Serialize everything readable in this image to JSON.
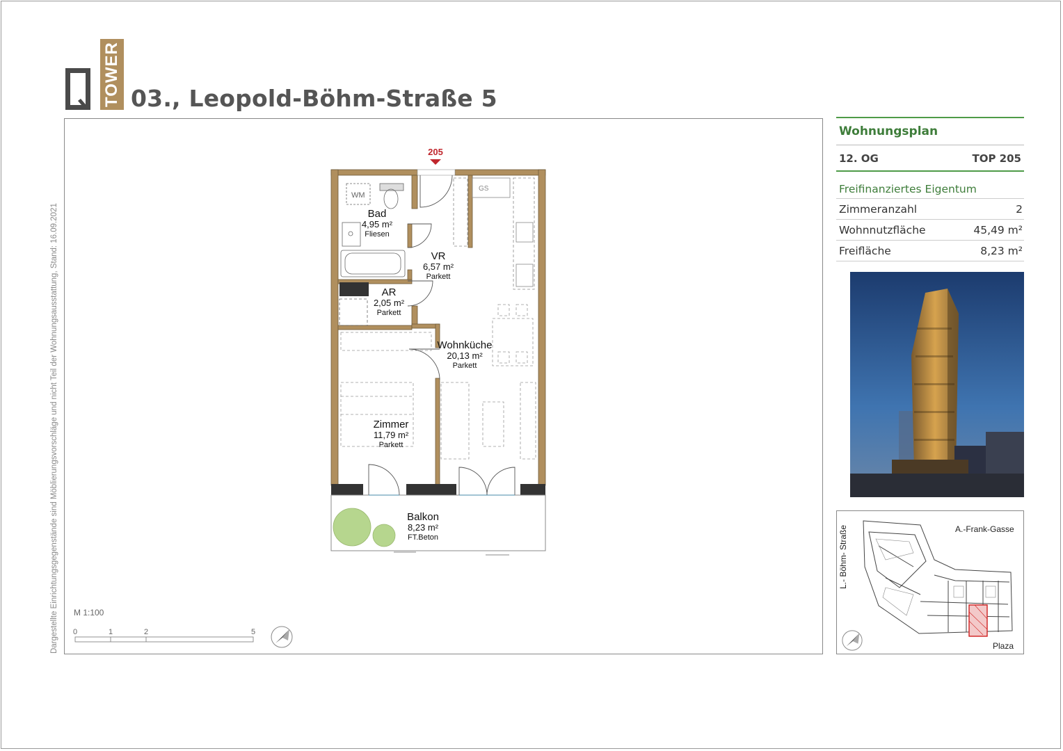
{
  "header": {
    "logo_word": "TOWER",
    "title": "03., Leopold-Böhm-Straße 5"
  },
  "disclaimer": "Dargestellte Einrichtungsgegenstände sind Möblierungsvorschläge und nicht Teil der Wohnungsausstattung, Stand: 16.09.2021",
  "plan": {
    "unit_marker": "205",
    "appliances": {
      "washer": "WM",
      "stove": "GS"
    },
    "rooms": [
      {
        "id": "bad",
        "name": "Bad",
        "area": "4,95 m²",
        "floor": "Fliesen"
      },
      {
        "id": "vr",
        "name": "VR",
        "area": "6,57 m²",
        "floor": "Parkett"
      },
      {
        "id": "ar",
        "name": "AR",
        "area": "2,05 m²",
        "floor": "Parkett"
      },
      {
        "id": "wohnkueche",
        "name": "Wohnküche",
        "area": "20,13 m²",
        "floor": "Parkett"
      },
      {
        "id": "zimmer",
        "name": "Zimmer",
        "area": "11,79 m²",
        "floor": "Parkett"
      },
      {
        "id": "balkon",
        "name": "Balkon",
        "area": "8,23 m²",
        "floor": "FT.Beton"
      }
    ],
    "scale": {
      "label": "M 1:100",
      "ticks": [
        "0",
        "1",
        "2",
        "5"
      ]
    }
  },
  "info": {
    "heading": "Wohnungsplan",
    "floor": "12. OG",
    "unit": "TOP 205",
    "ownership": "Freifinanziertes Eigentum",
    "rows": [
      {
        "label": "Zimmeranzahl",
        "value": "2"
      },
      {
        "label": "Wohnnutzfläche",
        "value": "45,49 m²"
      },
      {
        "label": "Freifläche",
        "value": "8,23 m²"
      }
    ]
  },
  "siteplan": {
    "street_left": "L.- Böhm- Straße",
    "street_top": "A.-Frank-Gasse",
    "plaza": "Plaza"
  },
  "colors": {
    "accent_green": "#4e9b47",
    "wall": "#b08f5e",
    "marker_red": "#c0272d",
    "plant_green": "#b6d68e"
  }
}
